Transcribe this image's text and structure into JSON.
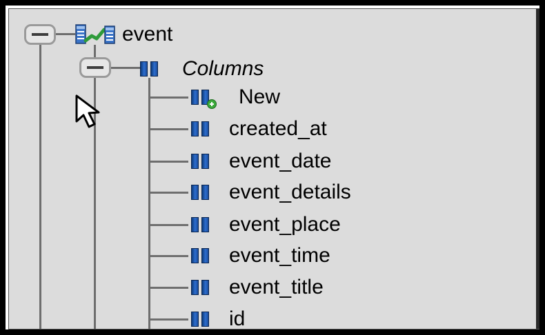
{
  "tree": {
    "table": {
      "label": "event",
      "icon": "table-icon",
      "expanded": true
    },
    "columns_folder": {
      "label": "Columns",
      "icon": "columns-icon",
      "expanded": true
    },
    "new_item": {
      "label": "New",
      "icon": "new-column-icon"
    },
    "columns": [
      {
        "label": "created_at",
        "icon": "column-icon"
      },
      {
        "label": "event_date",
        "icon": "column-icon"
      },
      {
        "label": "event_details",
        "icon": "column-icon"
      },
      {
        "label": "event_place",
        "icon": "column-icon"
      },
      {
        "label": "event_time",
        "icon": "column-icon"
      },
      {
        "label": "event_title",
        "icon": "column-icon"
      },
      {
        "label": "id",
        "icon": "column-icon"
      }
    ]
  },
  "colors": {
    "panel_background": "#dcdcdc",
    "tree_line": "#6e6e6e",
    "column_icon_blue": "#2d6ecf",
    "add_badge_green": "#3aa93a"
  }
}
